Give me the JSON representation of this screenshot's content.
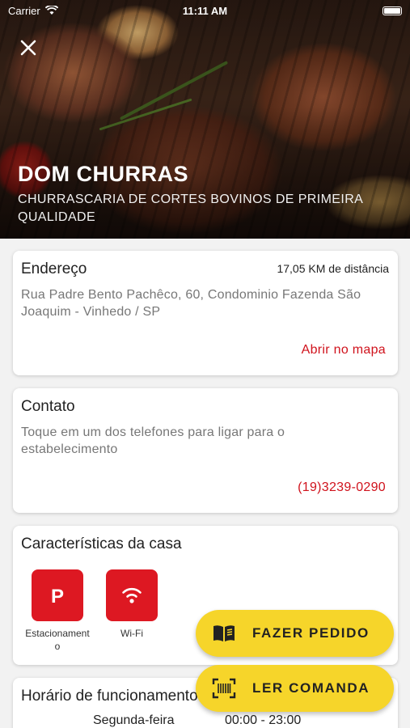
{
  "status_bar": {
    "carrier": "Carrier",
    "time": "11:11 AM"
  },
  "header": {
    "title": "DOM CHURRAS",
    "subtitle": "CHURRASCARIA DE CORTES BOVINOS DE PRIMEIRA QUALIDADE"
  },
  "address": {
    "title": "Endereço",
    "distance": "17,05 KM de distância",
    "text": "Rua Padre Bento Pachêco, 60, Condominio Fazenda São Joaquim - Vinhedo / SP",
    "link": "Abrir no mapa"
  },
  "contact": {
    "title": "Contato",
    "text": "Toque em um dos telefones para ligar para o estabelecimento",
    "phone": "(19)3239-0290"
  },
  "features": {
    "title": "Características da casa",
    "items": [
      {
        "label": "Estacionamento",
        "icon": "parking-icon"
      },
      {
        "label": "Wi-Fi",
        "icon": "wifi-icon"
      }
    ]
  },
  "hours": {
    "title": "Horário de funcionamento",
    "rows": [
      {
        "day": "Segunda-feira",
        "time": "00:00 - 23:00"
      }
    ]
  },
  "actions": {
    "order_label": "FAZER PEDIDO",
    "scan_label": "LER COMANDA"
  },
  "colors": {
    "accent": "#d0121c",
    "fab": "#f6d52a",
    "feature_tile": "#dd1822"
  }
}
